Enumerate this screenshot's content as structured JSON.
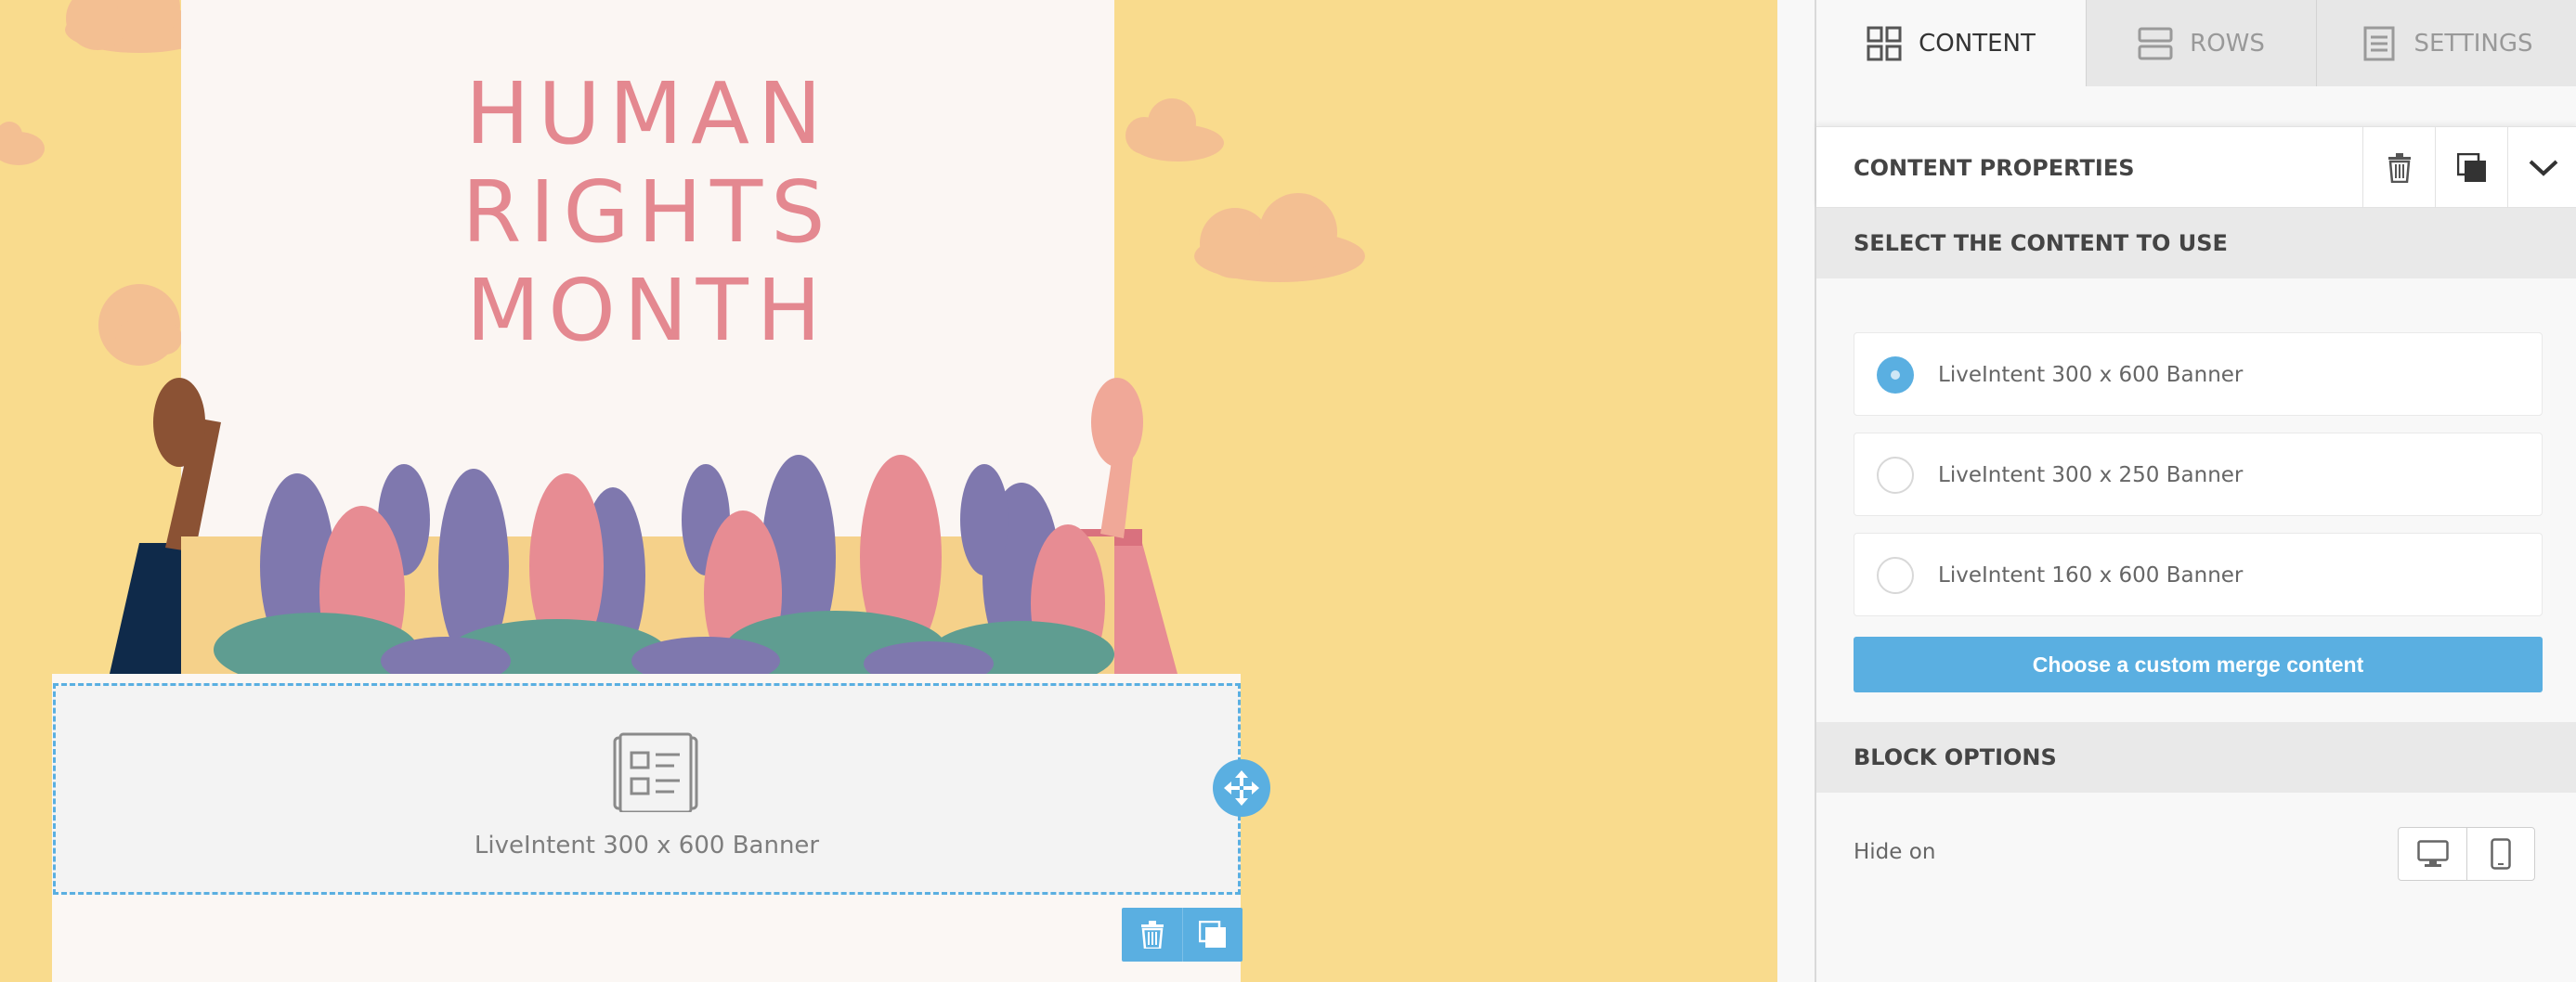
{
  "poster": {
    "title_line1": "HUMAN",
    "title_line2": "RIGHTS",
    "title_line3": "MONTH"
  },
  "block": {
    "label": "LiveIntent 300 x 600 Banner"
  },
  "sidebar": {
    "tabs": [
      {
        "label": "CONTENT",
        "icon": "grid-icon",
        "active": true
      },
      {
        "label": "ROWS",
        "icon": "rows-icon",
        "active": false
      },
      {
        "label": "SETTINGS",
        "icon": "settings-doc-icon",
        "active": false
      }
    ],
    "content_properties": {
      "title": "CONTENT PROPERTIES"
    },
    "select_section": {
      "title": "SELECT THE CONTENT TO USE",
      "options": [
        {
          "label": "LiveIntent 300 x 600 Banner",
          "selected": true
        },
        {
          "label": "LiveIntent 300 x 250 Banner",
          "selected": false
        },
        {
          "label": "LiveIntent 160 x 600 Banner",
          "selected": false
        }
      ],
      "custom_button": "Choose a custom merge content"
    },
    "block_options": {
      "title": "BLOCK OPTIONS",
      "hide_on_label": "Hide on"
    }
  },
  "colors": {
    "accent": "#5aafe1",
    "stage_background": "#f9db8d",
    "poster_title": "#e48890"
  }
}
